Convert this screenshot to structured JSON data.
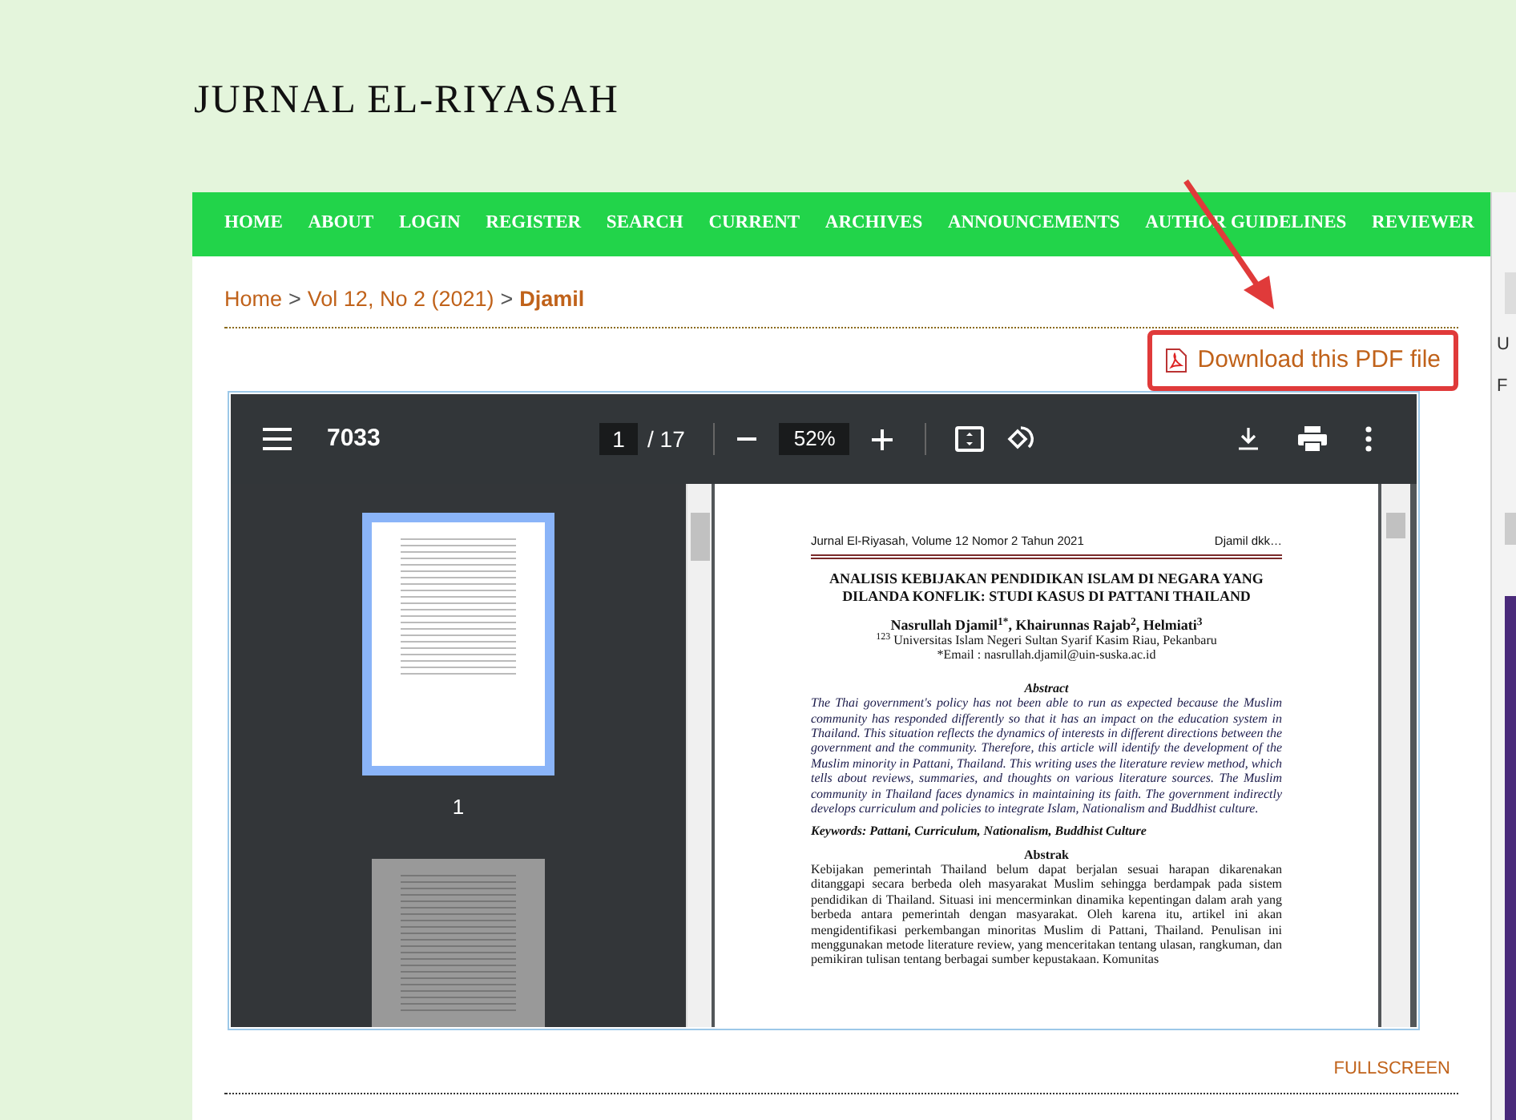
{
  "site_title": "JURNAL EL-RIYASAH",
  "nav": [
    {
      "label": "HOME"
    },
    {
      "label": "ABOUT"
    },
    {
      "label": "LOGIN"
    },
    {
      "label": "REGISTER"
    },
    {
      "label": "SEARCH"
    },
    {
      "label": "CURRENT"
    },
    {
      "label": "ARCHIVES"
    },
    {
      "label": "ANNOUNCEMENTS"
    },
    {
      "label": "AUTHOR GUIDELINES"
    },
    {
      "label": "REVIEWER"
    }
  ],
  "breadcrumb": [
    {
      "label": "Home",
      "current": false
    },
    {
      "label": "Vol 12, No 2 (2021)",
      "current": false
    },
    {
      "label": "Djamil",
      "current": true
    }
  ],
  "breadcrumb_separator": ">",
  "download_link": {
    "label": "Download this PDF file",
    "highlighted": true
  },
  "pdf_viewer": {
    "document_title": "7033",
    "page_input": "1",
    "page_total": "/ 17",
    "zoom": "52%",
    "thumbnails": [
      {
        "label": "1",
        "selected": true
      },
      {
        "selected": false
      }
    ],
    "page": {
      "header_left": "Jurnal El-Riyasah, Volume 12 Nomor 2 Tahun 2021",
      "header_right": "Djamil dkk…",
      "title": "ANALISIS KEBIJAKAN PENDIDIKAN ISLAM DI NEGARA YANG DILANDA KONFLIK: STUDI KASUS DI PATTANI THAILAND",
      "authors": "Nasrullah Djamil$^{1*}$, Khairunnas Rajab$^{2}$, Helmiati$^{3}$",
      "affiliation": "$^{123}$ Universitas Islam Negeri Sultan Syarif Kasim Riau, Pekanbaru",
      "email": "*Email : nasrullah.djamil@uin-suska.ac.id",
      "abstract_heading": "Abstract",
      "abstract": "The Thai government's policy has not been able to run as expected because the Muslim community has responded differently so that it has an impact on the education system in Thailand. This situation reflects the dynamics of interests in different directions between the government and the community. Therefore, this article will identify the development of the Muslim minority in Pattani, Thailand. This writing uses the literature review method, which tells about reviews, summaries, and thoughts on various literature sources. The Muslim community in Thailand faces dynamics in maintaining its faith. The government indirectly develops curriculum and policies to integrate Islam, Nationalism and Buddhist culture.",
      "keywords": "Keywords: Pattani, Curriculum, Nationalism, Buddhist Culture",
      "abstrak_heading": "Abstrak",
      "abstrak": "Kebijakan pemerintah Thailand belum dapat berjalan sesuai harapan dikarenakan ditanggapi secara berbeda oleh masyarakat Muslim sehingga berdampak pada sistem pendidikan di Thailand. Situasi ini mencerminkan dinamika kepentingan dalam arah yang berbeda antara pemerintah dengan masyarakat. Oleh karena itu, artikel ini akan mengidentifikasi perkembangan minoritas Muslim di Pattani, Thailand. Penulisan ini menggunakan metode literature review, yang menceritakan tentang ulasan, rangkuman, dan pemikiran tulisan tentang berbagai sumber kepustakaan. Komunitas"
    }
  },
  "fullscreen_link": "FULLSCREEN",
  "sidebar": [
    {
      "label": "U"
    },
    {
      "label": "F"
    }
  ]
}
